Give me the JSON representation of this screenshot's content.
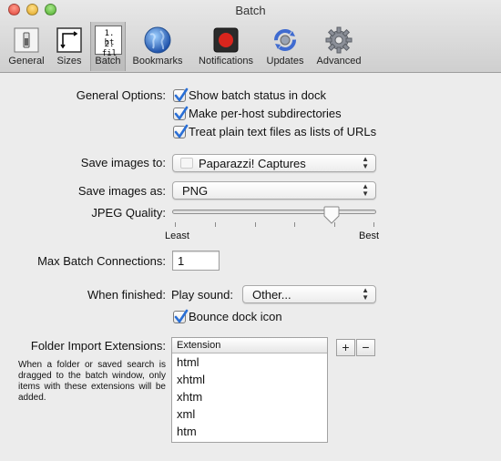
{
  "window": {
    "title": "Batch"
  },
  "toolbar": {
    "items": [
      {
        "label": "General",
        "icon": "switch-icon"
      },
      {
        "label": "Sizes",
        "icon": "sizes-icon"
      },
      {
        "label": "Batch",
        "icon": "batch-list-icon",
        "selected": true
      },
      {
        "label": "Bookmarks",
        "icon": "globe-icon"
      },
      {
        "label": "Notifications",
        "icon": "record-icon"
      },
      {
        "label": "Updates",
        "icon": "sync-icon"
      },
      {
        "label": "Advanced",
        "icon": "gear-icon"
      }
    ],
    "batch_icon_lines": [
      "1. ht",
      "2. fil"
    ]
  },
  "general_options": {
    "label": "General Options:",
    "options": [
      {
        "label": "Show batch status in dock",
        "checked": true
      },
      {
        "label": "Make per-host subdirectories",
        "checked": true
      },
      {
        "label": "Treat plain text files as lists of URLs",
        "checked": true
      }
    ]
  },
  "save_to": {
    "label": "Save images to:",
    "value": "Paparazzi! Captures"
  },
  "save_as": {
    "label": "Save images as:",
    "value": "PNG"
  },
  "jpeg_quality": {
    "label": "JPEG Quality:",
    "min_label": "Least",
    "max_label": "Best",
    "value_fraction": 0.78
  },
  "max_batch": {
    "label": "Max Batch Connections:",
    "value": "1"
  },
  "when_finished": {
    "label": "When finished:",
    "play_sound_label": "Play sound:",
    "sound_value": "Other...",
    "bounce_label": "Bounce dock icon",
    "bounce_checked": true
  },
  "folder_import": {
    "label": "Folder Import Extensions:",
    "help": "When a folder or saved search is dragged to the batch window, only items with these extensions will be added.",
    "column_header": "Extension",
    "extensions": [
      "html",
      "xhtml",
      "xhtm",
      "xml",
      "htm"
    ],
    "add_label": "+",
    "remove_label": "−"
  },
  "colors": {
    "check_blue": "#2a6fd6",
    "record_red": "#d9251d"
  }
}
